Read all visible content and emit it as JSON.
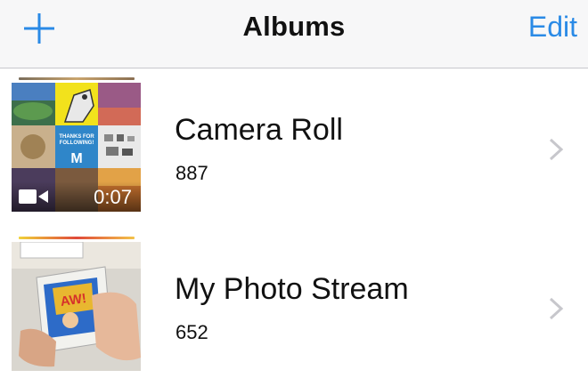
{
  "navbar": {
    "title": "Albums",
    "edit_label": "Edit",
    "add_icon": "plus-icon"
  },
  "colors": {
    "accent": "#2a8ae6",
    "navbar_bg": "#f7f7f8",
    "separator": "#c8c7cc",
    "chevron": "#c7c7cc"
  },
  "albums": [
    {
      "name": "Camera Roll",
      "count": "887",
      "video_duration": "0:07",
      "thumb_text_top": "THANKS FOR",
      "thumb_text_bottom": "FOLLOWING!",
      "thumb_letter": "M"
    },
    {
      "name": "My Photo Stream",
      "count": "652",
      "thumb_text": "AW!"
    }
  ]
}
